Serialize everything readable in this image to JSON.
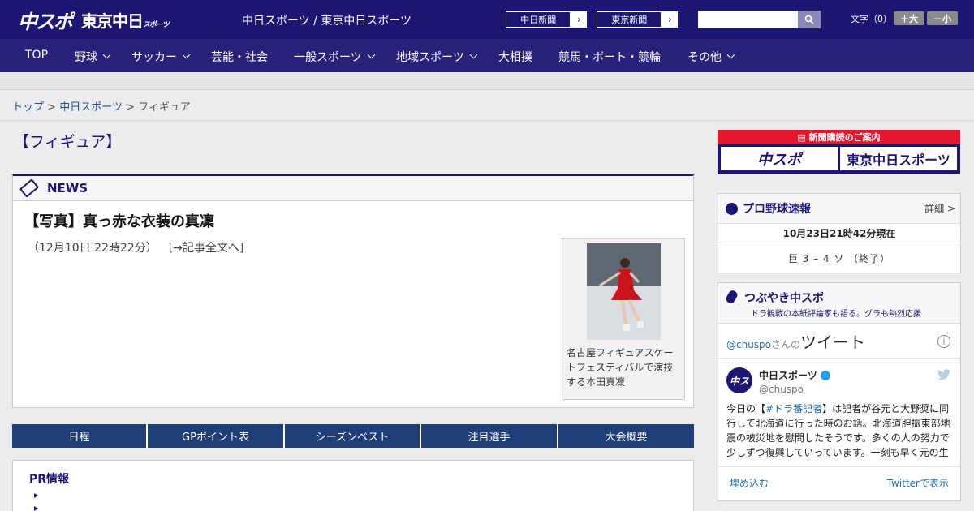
{
  "header": {
    "logo_chuspo": "中スポ",
    "logo_tokyo": "東京中日",
    "logo_tokyo_sub": "スポーツ",
    "site_title": "中日スポーツ / 東京中日スポーツ",
    "btn_chunichi": "中日新聞",
    "btn_tokyo": "東京新聞",
    "search_placeholder": "",
    "font_label": "文字（0）",
    "font_up": "＋大",
    "font_down": "－小"
  },
  "nav": {
    "items": [
      {
        "label": "TOP",
        "chevron": false
      },
      {
        "label": "野球",
        "chevron": true
      },
      {
        "label": "サッカー",
        "chevron": true
      },
      {
        "label": "芸能・社会",
        "chevron": false
      },
      {
        "label": "一般スポーツ",
        "chevron": true
      },
      {
        "label": "地域スポーツ",
        "chevron": true
      },
      {
        "label": "大相撲",
        "chevron": false
      },
      {
        "label": "競馬・ボート・競輪",
        "chevron": false
      },
      {
        "label": "その他",
        "chevron": true
      }
    ]
  },
  "breadcrumb": {
    "top": "トップ",
    "sep": " > ",
    "section": "中日スポーツ",
    "current": "フィギュア"
  },
  "page_title": "【フィギュア】",
  "news": {
    "header": "NEWS",
    "title": "【写真】真っ赤な衣装の真凜",
    "date": "（12月10日 22時22分）",
    "readmore": "[→記事全文へ]",
    "caption": "名古屋フィギュアスケートフェスティバルで演技する本田真凜"
  },
  "tabs": [
    "日程",
    "GPポイント表",
    "シーズンベスト",
    "注目選手",
    "大会概要"
  ],
  "pr": {
    "title": "PR情報"
  },
  "sidebar": {
    "subscribe_head": "新聞購読のご案内",
    "sub_chuspo": "中スポ",
    "sub_tokyo": "東京中日スポーツ",
    "baseball": {
      "title": "プロ野球速報",
      "detail": "詳細 >",
      "time": "10月23日21時42分現在",
      "score": "巨 3 – 4 ソ （終了）"
    },
    "tweets": {
      "title": "つぶやき中スポ",
      "subtitle": "ドラ観戦の本紙評論家も語る。グラも熱烈応援",
      "embed_handle": "@chuspo",
      "embed_san": "さんの",
      "embed_tweet": "ツイート",
      "name": "中日スポーツ",
      "handle": "@chuspo",
      "body_pre": "今日の【",
      "body_tag": "#ドラ番記者",
      "body_post": "】は記者が谷元と大野奨に同行して北海道に行った時のお話。北海道胆振東部地震の被災地を慰問したそうです。多くの人の努力で少しずつ復興していっています。一刻も早く元の生",
      "embed_link": "埋め込む",
      "view_link": "Twitterで表示"
    }
  },
  "colors": {
    "header_bg": "#1b1672",
    "nav_bg": "#272279",
    "tab_bg": "#1f3e78",
    "subscribe_red": "#e2162d",
    "link_blue": "#1f6fb5"
  }
}
